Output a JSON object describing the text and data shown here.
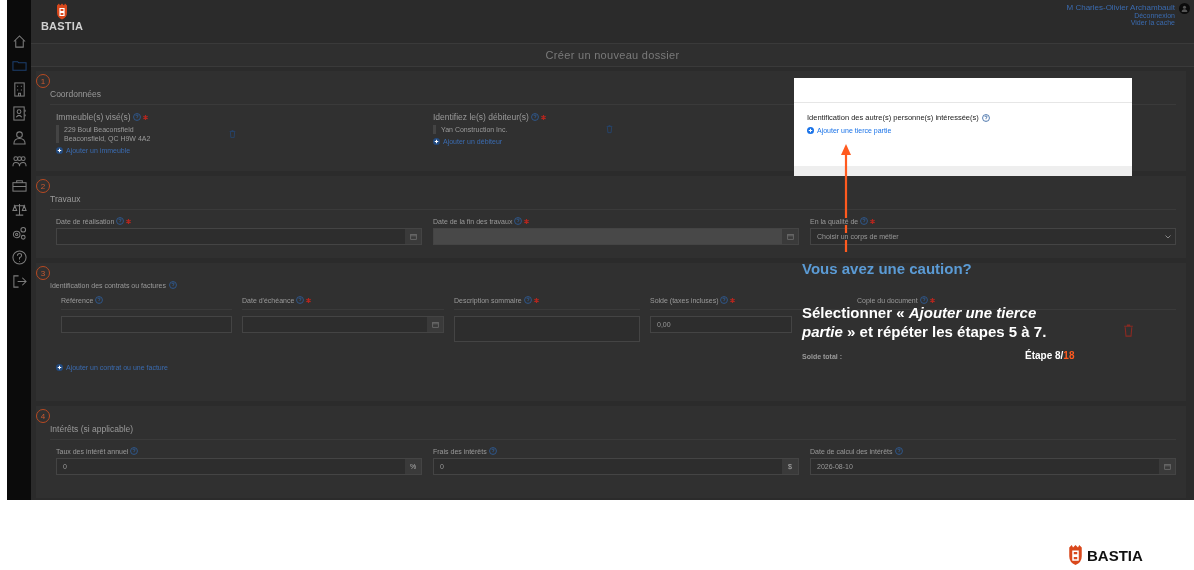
{
  "header": {
    "logo": "BASTIA",
    "user": "M Charles-Olivier Archambault",
    "links": [
      "Déconnexion",
      "Vider la cache"
    ]
  },
  "sidebar": {
    "items": [
      {
        "kind": "home",
        "selected": false
      },
      {
        "kind": "folder",
        "selected": true
      },
      {
        "kind": "building",
        "selected": false
      },
      {
        "kind": "contact",
        "selected": false
      },
      {
        "kind": "person",
        "selected": false
      },
      {
        "kind": "group",
        "selected": false
      },
      {
        "kind": "briefcase",
        "selected": false
      },
      {
        "kind": "scales",
        "selected": false
      },
      {
        "kind": "gears",
        "selected": false
      },
      {
        "kind": "help",
        "selected": false
      },
      {
        "kind": "logout",
        "selected": false
      }
    ]
  },
  "page_title": "Créer un nouveau dossier",
  "sections": [
    {
      "kind": "fields",
      "number": "1",
      "title": "Coordonnées",
      "fields": [
        {
          "kind": "list",
          "label": "Immeuble(s) visé(s)",
          "help": true,
          "required": true,
          "lines": [
            "229 Boul Beaconsfield",
            "Beaconsfield, QC  H9W 4A2"
          ],
          "link": "Ajouter un immeuble"
        },
        {
          "kind": "list",
          "label": "Identifiez le(s) débiteur(s)",
          "help": true,
          "required": true,
          "lines": [
            "Yan Construction Inc."
          ],
          "link": "Ajouter un débiteur"
        }
      ]
    },
    {
      "kind": "fields",
      "number": "2",
      "title": "Travaux",
      "fields": [
        {
          "kind": "date",
          "label": "Date de réalisation",
          "help": true,
          "required": true,
          "disabled": false
        },
        {
          "kind": "date",
          "label": "Date de la fin des travaux",
          "help": true,
          "required": true,
          "disabled": true
        },
        {
          "kind": "select",
          "label": "En la qualité de",
          "help": true,
          "required": true,
          "value": "Choisir un corps de métier"
        }
      ]
    },
    {
      "kind": "table",
      "number": "3",
      "title": "Identification des contrats ou factures",
      "columns": [
        {
          "kind": "text",
          "label": "Référence",
          "help": true,
          "required": false
        },
        {
          "kind": "date",
          "label": "Date d'échéance",
          "help": true,
          "required": true
        },
        {
          "kind": "textarea",
          "label": "Description sommaire",
          "help": true,
          "required": true
        },
        {
          "kind": "amount",
          "label": "Solde (taxes incluses)",
          "help": true,
          "required": true,
          "value": "0,00"
        },
        {
          "kind": "file",
          "label": "Copie du document",
          "help": true,
          "required": true
        }
      ],
      "total_label": "Solde total :",
      "link": "Ajouter un contrat ou une facture"
    },
    {
      "kind": "fields",
      "number": "4",
      "title": "Intérêts (si applicable)",
      "fields": [
        {
          "kind": "number",
          "label": "Taux des intérêt annuel",
          "help": true,
          "required": false,
          "value": "0",
          "suffix": "%"
        },
        {
          "kind": "number",
          "label": "Frais des intérêts",
          "help": true,
          "required": false,
          "value": "0",
          "suffix": "$"
        },
        {
          "kind": "date",
          "label": "Date de calcul des intérêts",
          "help": true,
          "required": false,
          "disabled": false,
          "value": "2026-08-10"
        }
      ]
    }
  ],
  "popup": {
    "heading": "Identification des autre(s) personne(s) intéressée(s)",
    "link": "Ajouter une tierce partie"
  },
  "callout": {
    "title": "Vous avez une caution?",
    "text": "Sélectionner « *Ajouter une tierce partie* » et répéter les étapes 5 à 7.",
    "step": "Étape 8/",
    "step_total": "18"
  },
  "footer": {
    "logo": "BASTIA"
  }
}
